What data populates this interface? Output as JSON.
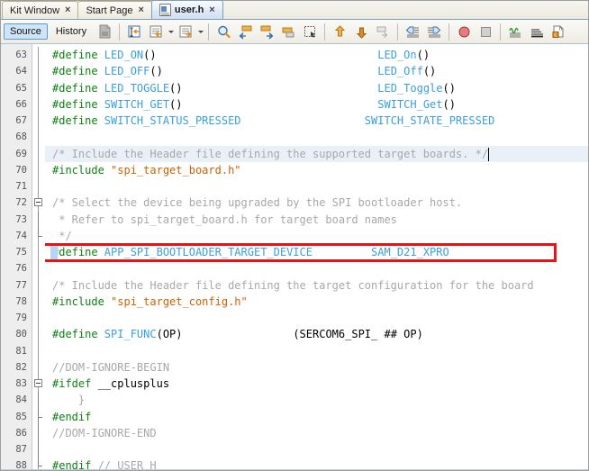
{
  "window": {
    "title": "user.h"
  },
  "tabs": [
    {
      "label": "Kit Window",
      "active": false,
      "icon": "",
      "close": "×"
    },
    {
      "label": "Start Page",
      "active": false,
      "icon": "",
      "close": "×"
    },
    {
      "label": "user.h",
      "active": true,
      "icon": "header-file-icon",
      "close": "×"
    }
  ],
  "toolbar": {
    "source_label": "Source",
    "history_label": "History",
    "buttons": [
      {
        "name": "print-preview-icon",
        "enabled": false
      },
      {
        "name": "shift-line-left-icon",
        "enabled": true
      },
      {
        "name": "format-block-icon",
        "enabled": true,
        "has_caret": true
      },
      {
        "name": "comment-block-icon",
        "enabled": true,
        "has_caret": true
      },
      {
        "name": "find-selection-icon",
        "enabled": true
      },
      {
        "name": "previous-bookmark-icon",
        "enabled": true
      },
      {
        "name": "next-bookmark-icon",
        "enabled": true
      },
      {
        "name": "toggle-bookmark-icon",
        "enabled": true
      },
      {
        "name": "rectangular-selection-icon",
        "enabled": true
      },
      {
        "name": "last-edit-icon",
        "enabled": true
      },
      {
        "name": "back-navigate-icon",
        "enabled": true
      },
      {
        "name": "forward-navigate-icon",
        "enabled": false
      },
      {
        "name": "shift-left-icon",
        "enabled": true
      },
      {
        "name": "shift-right-icon",
        "enabled": true
      },
      {
        "name": "stop-build-icon",
        "enabled": true
      },
      {
        "name": "pause-icon",
        "enabled": true
      },
      {
        "name": "toggle-highlight-icon",
        "enabled": true
      },
      {
        "name": "toggle-line-numbers-icon",
        "enabled": true
      },
      {
        "name": "inspect-header-icon",
        "enabled": true
      }
    ]
  },
  "editor": {
    "first_line_number": 63,
    "current_line_number": 69,
    "annotation": {
      "type": "red-rectangle",
      "target_line": 75,
      "label": "highlighted-define-line"
    },
    "lines": [
      {
        "num": 63,
        "fold": "none",
        "tokens": [
          {
            "t": "#define ",
            "c": "pp"
          },
          {
            "t": "LED_ON",
            "c": "macro"
          },
          {
            "t": "()",
            "c": "plain"
          },
          {
            "t": "                                  ",
            "c": "plain"
          },
          {
            "t": "LED_On",
            "c": "macro"
          },
          {
            "t": "()",
            "c": "plain"
          }
        ]
      },
      {
        "num": 64,
        "fold": "none",
        "tokens": [
          {
            "t": "#define ",
            "c": "pp"
          },
          {
            "t": "LED_OFF",
            "c": "macro"
          },
          {
            "t": "()",
            "c": "plain"
          },
          {
            "t": "                                 ",
            "c": "plain"
          },
          {
            "t": "LED_Off",
            "c": "macro"
          },
          {
            "t": "()",
            "c": "plain"
          }
        ]
      },
      {
        "num": 65,
        "fold": "none",
        "tokens": [
          {
            "t": "#define ",
            "c": "pp"
          },
          {
            "t": "LED_TOGGLE",
            "c": "macro"
          },
          {
            "t": "()",
            "c": "plain"
          },
          {
            "t": "                              ",
            "c": "plain"
          },
          {
            "t": "LED_Toggle",
            "c": "macro"
          },
          {
            "t": "()",
            "c": "plain"
          }
        ]
      },
      {
        "num": 66,
        "fold": "none",
        "tokens": [
          {
            "t": "#define ",
            "c": "pp"
          },
          {
            "t": "SWITCH_GET",
            "c": "macro"
          },
          {
            "t": "()",
            "c": "plain"
          },
          {
            "t": "                              ",
            "c": "plain"
          },
          {
            "t": "SWITCH_Get",
            "c": "macro"
          },
          {
            "t": "()",
            "c": "plain"
          }
        ]
      },
      {
        "num": 67,
        "fold": "none",
        "tokens": [
          {
            "t": "#define ",
            "c": "pp"
          },
          {
            "t": "SWITCH_STATUS_PRESSED",
            "c": "macro"
          },
          {
            "t": "                   ",
            "c": "plain"
          },
          {
            "t": "SWITCH_STATE_PRESSED",
            "c": "macro"
          }
        ]
      },
      {
        "num": 68,
        "fold": "none",
        "tokens": []
      },
      {
        "num": 69,
        "fold": "none",
        "current": true,
        "caret_after": true,
        "tokens": [
          {
            "t": "/* Include the Header file defining the supported target boards. */",
            "c": "comment"
          }
        ]
      },
      {
        "num": 70,
        "fold": "none",
        "tokens": [
          {
            "t": "#include ",
            "c": "pp"
          },
          {
            "t": "\"spi_target_board.h\"",
            "c": "string"
          }
        ]
      },
      {
        "num": 71,
        "fold": "none",
        "tokens": []
      },
      {
        "num": 72,
        "fold": "start",
        "tokens": [
          {
            "t": "/* Select the device being upgraded by the SPI bootloader host.",
            "c": "comment"
          }
        ]
      },
      {
        "num": 73,
        "fold": "mid",
        "tokens": [
          {
            "t": " * Refer to spi_target_board.h for target board names",
            "c": "comment"
          }
        ]
      },
      {
        "num": 74,
        "fold": "end",
        "tokens": [
          {
            "t": " */",
            "c": "comment"
          }
        ]
      },
      {
        "num": 75,
        "fold": "none",
        "boxed": true,
        "selected_prefix": true,
        "tokens": [
          {
            "t": "#define ",
            "c": "pp"
          },
          {
            "t": "APP_SPI_BOOTLOADER_TARGET_DEVICE",
            "c": "macro"
          },
          {
            "t": "         ",
            "c": "plain"
          },
          {
            "t": "SAM_D21_XPRO",
            "c": "macro"
          }
        ]
      },
      {
        "num": 76,
        "fold": "none",
        "tokens": []
      },
      {
        "num": 77,
        "fold": "none",
        "tokens": [
          {
            "t": "/* Include the Header file defining the target configuration for the board",
            "c": "comment"
          }
        ]
      },
      {
        "num": 78,
        "fold": "none",
        "tokens": [
          {
            "t": "#include ",
            "c": "pp"
          },
          {
            "t": "\"spi_target_config.h\"",
            "c": "string"
          }
        ]
      },
      {
        "num": 79,
        "fold": "none",
        "tokens": []
      },
      {
        "num": 80,
        "fold": "none",
        "tokens": [
          {
            "t": "#define ",
            "c": "pp"
          },
          {
            "t": "SPI_FUNC",
            "c": "macro"
          },
          {
            "t": "(OP)",
            "c": "plain"
          },
          {
            "t": "                 ",
            "c": "plain"
          },
          {
            "t": "(SERCOM6_SPI_ ## OP)",
            "c": "plain"
          }
        ]
      },
      {
        "num": 81,
        "fold": "none",
        "tokens": []
      },
      {
        "num": 82,
        "fold": "none",
        "tokens": [
          {
            "t": "//DOM-IGNORE-BEGIN",
            "c": "comment"
          }
        ]
      },
      {
        "num": 83,
        "fold": "start",
        "tokens": [
          {
            "t": "#ifdef ",
            "c": "pp"
          },
          {
            "t": "__cplusplus",
            "c": "plain"
          }
        ]
      },
      {
        "num": 84,
        "fold": "mid",
        "tokens": [
          {
            "t": "    }",
            "c": "comment"
          }
        ]
      },
      {
        "num": 85,
        "fold": "end",
        "tokens": [
          {
            "t": "#endif",
            "c": "pp"
          }
        ]
      },
      {
        "num": 86,
        "fold": "none",
        "tokens": [
          {
            "t": "//DOM-IGNORE-END",
            "c": "comment"
          }
        ]
      },
      {
        "num": 87,
        "fold": "none",
        "tokens": []
      },
      {
        "num": 88,
        "fold": "outer-end",
        "tokens": [
          {
            "t": "#endif ",
            "c": "pp"
          },
          {
            "t": "// USER_H",
            "c": "comment"
          }
        ]
      }
    ]
  },
  "colors": {
    "preprocessor": "#0f7f12",
    "macro": "#3a9fdc",
    "comment": "#a8a8a8",
    "string": "#d06000",
    "annotation": "#ee1111",
    "current_line": "#eaf0f8",
    "gutter": "#eeeeee",
    "tab_active": "#cfe0f2"
  }
}
